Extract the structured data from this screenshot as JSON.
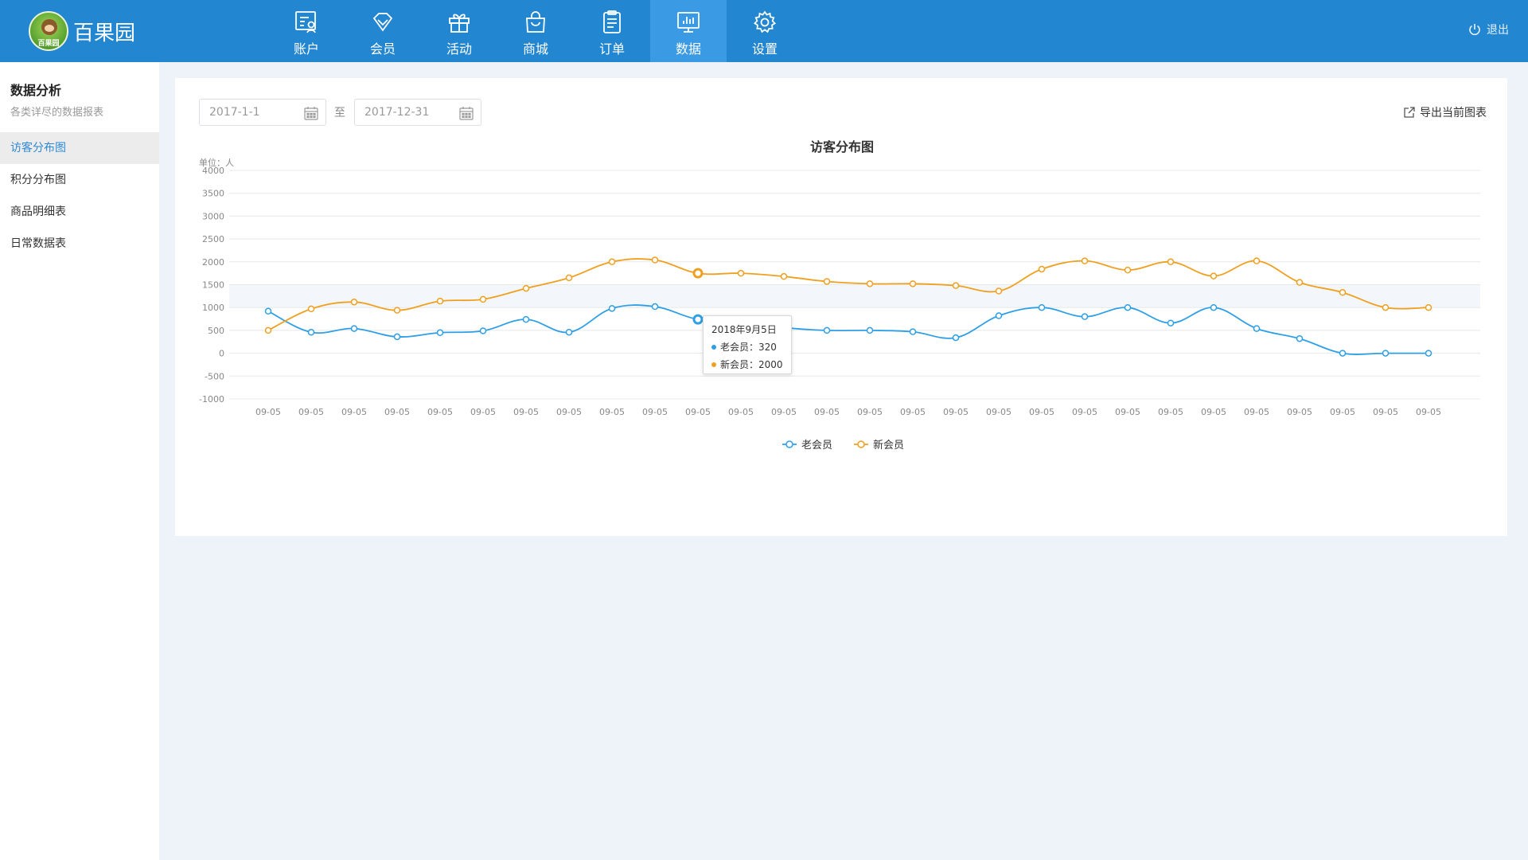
{
  "brand": {
    "name": "百果园",
    "logo_text": "百果园"
  },
  "nav": [
    {
      "label": "账户",
      "icon": "account-icon"
    },
    {
      "label": "会员",
      "icon": "diamond-icon"
    },
    {
      "label": "活动",
      "icon": "gift-icon"
    },
    {
      "label": "商城",
      "icon": "shopping-bag-icon"
    },
    {
      "label": "订单",
      "icon": "clipboard-icon"
    },
    {
      "label": "数据",
      "icon": "bar-chart-icon",
      "active": true
    },
    {
      "label": "设置",
      "icon": "gear-icon"
    }
  ],
  "logout": {
    "label": "退出",
    "icon": "power-icon"
  },
  "sidebar": {
    "title": "数据分析",
    "subtitle": "各类详尽的数据报表",
    "items": [
      {
        "label": "访客分布图",
        "active": true
      },
      {
        "label": "积分分布图"
      },
      {
        "label": "商品明细表"
      },
      {
        "label": "日常数据表"
      }
    ]
  },
  "filters": {
    "start_date": "2017-1-1",
    "separator": "至",
    "end_date": "2017-12-31",
    "export_label": "导出当前图表"
  },
  "tooltip": {
    "title": "2018年9月5日",
    "rows": [
      {
        "label": "老会员：320",
        "color": "#2e9fe6"
      },
      {
        "label": "新会员：2000",
        "color": "#f0a020"
      }
    ]
  },
  "colors": {
    "header": "#2386d0",
    "nav_active": "#3a9ae3",
    "old_member": "#2e9fe6",
    "new_member": "#f0a020",
    "background": "#eef3fa"
  },
  "chart_data": {
    "type": "line",
    "title": "访客分布图",
    "unit_label": "单位：人",
    "ylim": [
      -1000,
      4000
    ],
    "yticks": [
      4000,
      3500,
      3000,
      2500,
      2000,
      1500,
      1000,
      500,
      0,
      -500,
      -1000
    ],
    "categories": [
      "09-05",
      "09-05",
      "09-05",
      "09-05",
      "09-05",
      "09-05",
      "09-05",
      "09-05",
      "09-05",
      "09-05",
      "09-05",
      "09-05",
      "09-05",
      "09-05",
      "09-05",
      "09-05",
      "09-05",
      "09-05",
      "09-05",
      "09-05",
      "09-05",
      "09-05",
      "09-05",
      "09-05",
      "09-05",
      "09-05",
      "09-05",
      "09-05"
    ],
    "grid": true,
    "legend_position": "bottom-center",
    "series": [
      {
        "name": "老会员",
        "color": "#2e9fe6",
        "values": [
          920,
          460,
          540,
          360,
          450,
          490,
          740,
          460,
          980,
          1020,
          740,
          680,
          560,
          500,
          500,
          470,
          340,
          820,
          1000,
          800,
          1000,
          660,
          1000,
          540,
          320,
          0,
          0,
          0
        ]
      },
      {
        "name": "新会员",
        "color": "#f0a020",
        "values": [
          500,
          970,
          1120,
          940,
          1140,
          1180,
          1420,
          1650,
          2000,
          2040,
          1750,
          1750,
          1680,
          1570,
          1520,
          1520,
          1480,
          1360,
          1840,
          2020,
          1820,
          2000,
          1690,
          2020,
          1550,
          1330,
          1000,
          1000
        ]
      }
    ]
  }
}
